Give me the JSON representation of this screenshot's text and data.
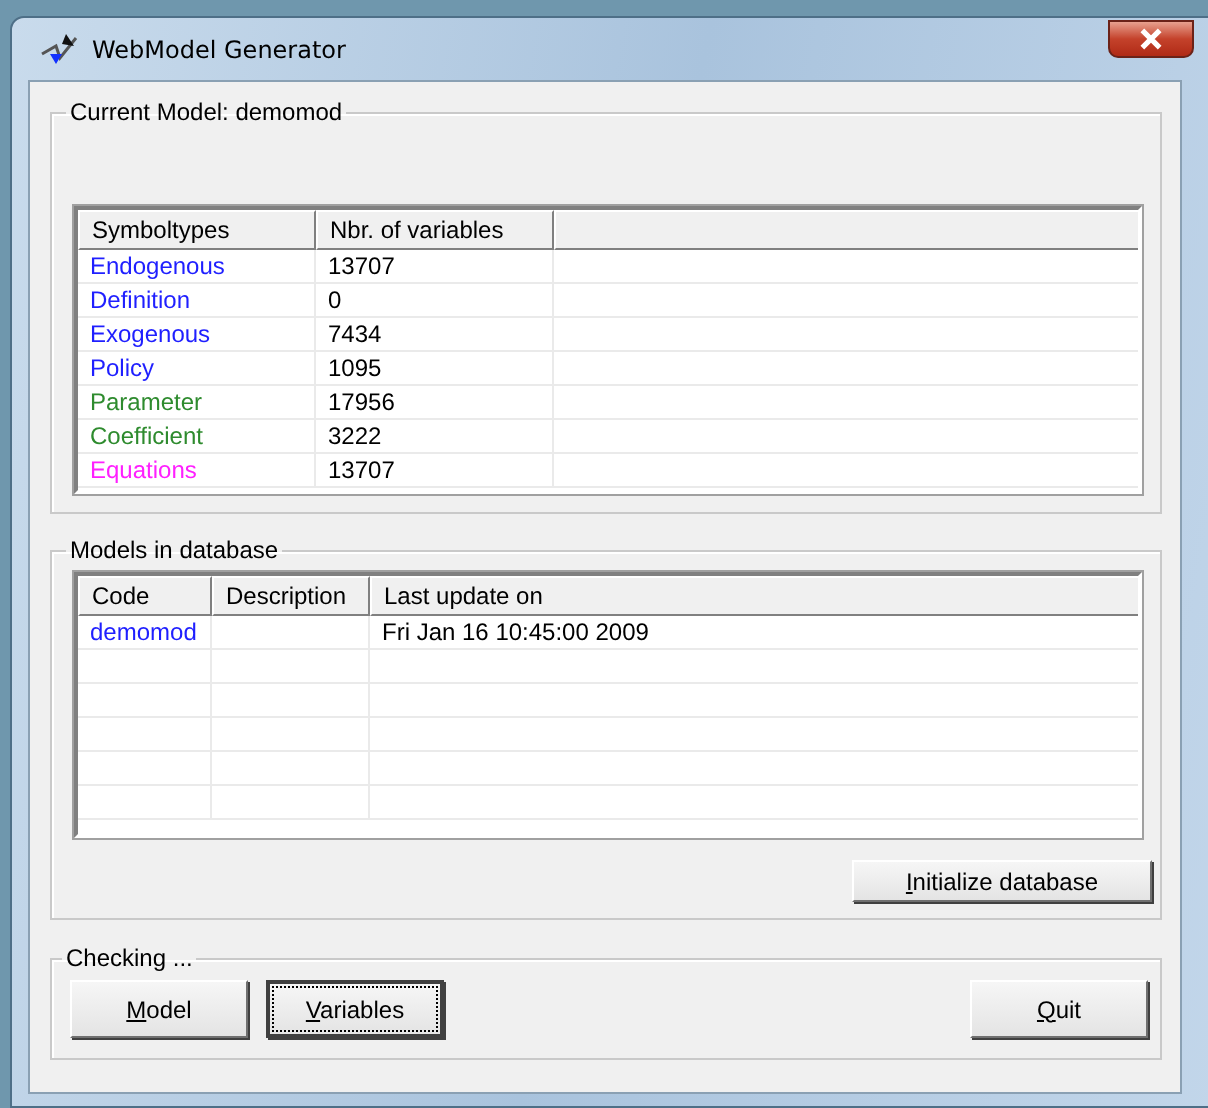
{
  "window": {
    "title": "WebModel Generator"
  },
  "current_model": {
    "legend": "Current Model: demomod",
    "table": {
      "columns": [
        "Symboltypes",
        "Nbr. of variables"
      ],
      "rows": [
        {
          "type": "Endogenous",
          "count": "13707",
          "color": "#1f1fff"
        },
        {
          "type": "Definition",
          "count": "0",
          "color": "#1f1fff"
        },
        {
          "type": "Exogenous",
          "count": "7434",
          "color": "#1f1fff"
        },
        {
          "type": "Policy",
          "count": "1095",
          "color": "#1f1fff"
        },
        {
          "type": "Parameter",
          "count": "17956",
          "color": "#2e8b2e"
        },
        {
          "type": "Coefficient",
          "count": "3222",
          "color": "#2e8b2e"
        },
        {
          "type": "Equations",
          "count": "13707",
          "color": "#ff1fff"
        }
      ]
    }
  },
  "models": {
    "legend": "Models in database",
    "table": {
      "columns": [
        "Code",
        "Description",
        "Last update on"
      ],
      "rows": [
        {
          "code": "demomod",
          "last_update": "Fri Jan 16 10:45:00 2009"
        }
      ]
    },
    "button": {
      "label": "Initialize database",
      "focused": false
    }
  },
  "checking": {
    "legend": "Checking ...",
    "buttons": [
      {
        "label": "Model",
        "focused": false
      },
      {
        "label": "Variables",
        "focused": true
      },
      {
        "label": "Quit",
        "focused": false
      }
    ]
  }
}
